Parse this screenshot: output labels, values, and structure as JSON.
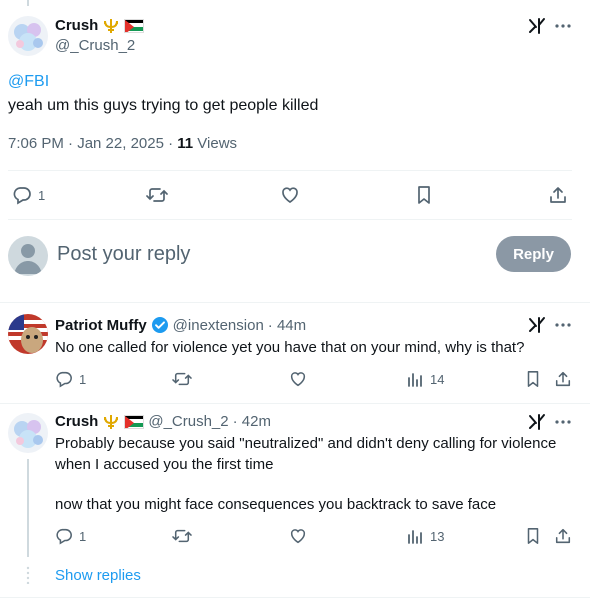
{
  "main_tweet": {
    "author_name": "Crush",
    "handle": "@_Crush_2",
    "mention": "@FBI",
    "text": "yeah um this guys trying to get people killed",
    "time": "7:06 PM · Jan 22, 2025 · ",
    "views_count": "11",
    "views_label": " Views",
    "reply_count": "1"
  },
  "compose": {
    "placeholder": "Post your reply",
    "reply_label": "Reply"
  },
  "replies": [
    {
      "author_name": "Patriot Muffy",
      "handle": "@inextension",
      "time": "· 44m",
      "text": "No one called for violence yet you have that on your mind, why is that?",
      "reply_count": "1",
      "views": "14"
    },
    {
      "author_name": "Crush",
      "handle": "@_Crush_2",
      "time": "· 42m",
      "text_line1": "Probably because you said \"neutralized\" and didn't deny calling for violence",
      "text_line2": "when I accused you the first time",
      "text_line3": "now that you might face consequences you backtrack to save face",
      "reply_count": "1",
      "views": "13"
    }
  ],
  "show_replies": "Show replies",
  "colors": {
    "accent": "#1d9bf0",
    "muted": "#536471",
    "verified": "#1d9bf0",
    "reply_button": "#8b98a5"
  }
}
